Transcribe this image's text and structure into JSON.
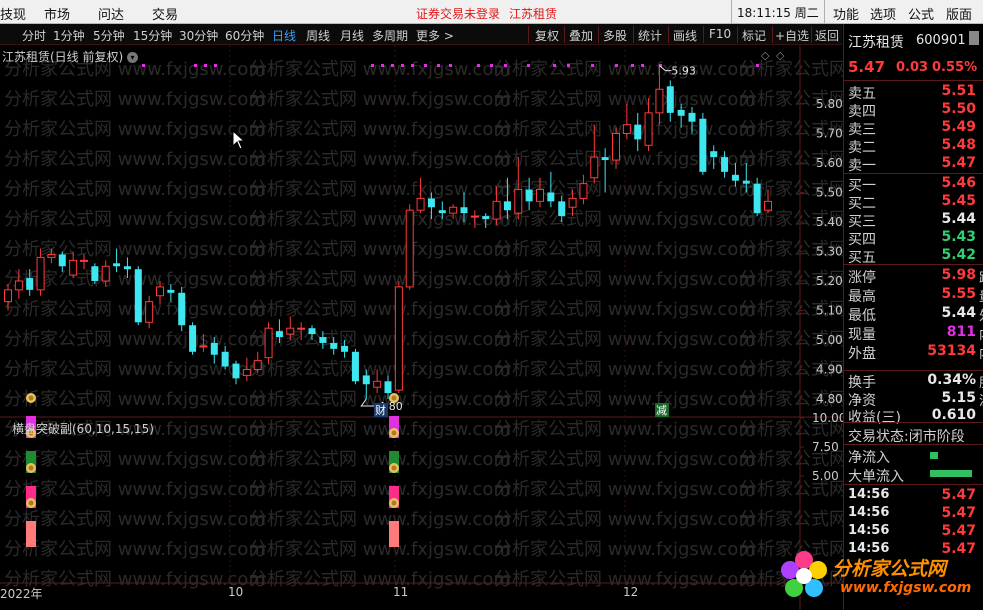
{
  "menubar": {
    "items": [
      "技现",
      "市场",
      "问达",
      "交易"
    ],
    "notice": "证券交易未登录",
    "stock_name": "江苏租赁",
    "clock": "18:11:15 周二",
    "right_items": [
      "功能",
      "选项",
      "公式",
      "版面"
    ]
  },
  "toolbar": {
    "periods": [
      "分时",
      "1分钟",
      "5分钟",
      "15分钟",
      "30分钟",
      "60分钟",
      "日线",
      "周线",
      "月线",
      "多周期",
      "更多 >"
    ],
    "active_period": "日线",
    "tools": [
      "复权",
      "叠加",
      "多股",
      "统计",
      "画线",
      "F10",
      "标记",
      "+自选",
      "返回"
    ]
  },
  "chart": {
    "title": "江苏租赁(日线 前复权)",
    "indicator_title": "横盘突破副(60,10,15,15)",
    "price_ticks": [
      "5.80",
      "5.70",
      "5.60",
      "5.50",
      "5.40",
      "5.30",
      "5.20",
      "5.10",
      "5.00",
      "4.90",
      "4.80"
    ],
    "ind_ticks": [
      "10.00",
      "7.50",
      "5.00"
    ],
    "high_marker": "5.93",
    "low_marker": "4.80",
    "event_a": "财",
    "event_b": "减",
    "x_labels": [
      "2022年",
      "10",
      "11",
      "12"
    ],
    "watermark_text": "分析家公式网 www.fxjgsw.com",
    "colors": {
      "up": "#ff3a3a",
      "down": "#3ee6f0",
      "axis": "#5a1a1a"
    }
  },
  "chart_data": {
    "type": "candlestick",
    "ylim": [
      4.75,
      5.98
    ],
    "ylabel": "",
    "candles": [
      {
        "o": 5.13,
        "c": 5.17,
        "h": 5.19,
        "l": 5.1
      },
      {
        "o": 5.17,
        "c": 5.2,
        "h": 5.24,
        "l": 5.14
      },
      {
        "o": 5.21,
        "c": 5.17,
        "h": 5.24,
        "l": 5.15
      },
      {
        "o": 5.17,
        "c": 5.28,
        "h": 5.31,
        "l": 5.15
      },
      {
        "o": 5.28,
        "c": 5.29,
        "h": 5.31,
        "l": 5.26
      },
      {
        "o": 5.29,
        "c": 5.25,
        "h": 5.3,
        "l": 5.23
      },
      {
        "o": 5.22,
        "c": 5.27,
        "h": 5.3,
        "l": 5.21
      },
      {
        "o": 5.27,
        "c": 5.27,
        "h": 5.29,
        "l": 5.24
      },
      {
        "o": 5.25,
        "c": 5.2,
        "h": 5.26,
        "l": 5.19
      },
      {
        "o": 5.2,
        "c": 5.25,
        "h": 5.27,
        "l": 5.18
      },
      {
        "o": 5.26,
        "c": 5.25,
        "h": 5.31,
        "l": 5.23
      },
      {
        "o": 5.25,
        "c": 5.24,
        "h": 5.28,
        "l": 5.21
      },
      {
        "o": 5.24,
        "c": 5.06,
        "h": 5.25,
        "l": 5.05
      },
      {
        "o": 5.06,
        "c": 5.13,
        "h": 5.15,
        "l": 5.04
      },
      {
        "o": 5.15,
        "c": 5.18,
        "h": 5.2,
        "l": 5.12
      },
      {
        "o": 5.17,
        "c": 5.16,
        "h": 5.19,
        "l": 5.13
      },
      {
        "o": 5.16,
        "c": 5.05,
        "h": 5.18,
        "l": 5.03
      },
      {
        "o": 5.05,
        "c": 4.96,
        "h": 5.06,
        "l": 4.95
      },
      {
        "o": 4.98,
        "c": 4.98,
        "h": 5.02,
        "l": 4.96
      },
      {
        "o": 4.99,
        "c": 4.95,
        "h": 5.01,
        "l": 4.92
      },
      {
        "o": 4.96,
        "c": 4.91,
        "h": 4.98,
        "l": 4.9
      },
      {
        "o": 4.92,
        "c": 4.87,
        "h": 4.93,
        "l": 4.85
      },
      {
        "o": 4.88,
        "c": 4.9,
        "h": 4.94,
        "l": 4.86
      },
      {
        "o": 4.9,
        "c": 4.93,
        "h": 4.96,
        "l": 4.89
      },
      {
        "o": 4.94,
        "c": 5.04,
        "h": 5.06,
        "l": 4.92
      },
      {
        "o": 5.03,
        "c": 5.01,
        "h": 5.07,
        "l": 4.99
      },
      {
        "o": 5.02,
        "c": 5.04,
        "h": 5.08,
        "l": 5.0
      },
      {
        "o": 5.04,
        "c": 5.04,
        "h": 5.06,
        "l": 5.0
      },
      {
        "o": 5.04,
        "c": 5.02,
        "h": 5.05,
        "l": 5.0
      },
      {
        "o": 5.01,
        "c": 4.99,
        "h": 5.03,
        "l": 4.97
      },
      {
        "o": 4.99,
        "c": 4.97,
        "h": 5.01,
        "l": 4.95
      },
      {
        "o": 4.98,
        "c": 4.96,
        "h": 5.0,
        "l": 4.94
      },
      {
        "o": 4.96,
        "c": 4.86,
        "h": 4.97,
        "l": 4.85
      },
      {
        "o": 4.88,
        "c": 4.85,
        "h": 4.9,
        "l": 4.8
      },
      {
        "o": 4.84,
        "c": 4.86,
        "h": 4.9,
        "l": 4.82
      },
      {
        "o": 4.86,
        "c": 4.82,
        "h": 4.88,
        "l": 4.8
      },
      {
        "o": 4.83,
        "c": 5.18,
        "h": 5.2,
        "l": 4.82
      },
      {
        "o": 5.18,
        "c": 5.44,
        "h": 5.46,
        "l": 5.17
      },
      {
        "o": 5.44,
        "c": 5.48,
        "h": 5.55,
        "l": 5.43
      },
      {
        "o": 5.48,
        "c": 5.45,
        "h": 5.5,
        "l": 5.41
      },
      {
        "o": 5.44,
        "c": 5.43,
        "h": 5.47,
        "l": 5.41
      },
      {
        "o": 5.43,
        "c": 5.45,
        "h": 5.46,
        "l": 5.41
      },
      {
        "o": 5.45,
        "c": 5.43,
        "h": 5.5,
        "l": 5.4
      },
      {
        "o": 5.42,
        "c": 5.42,
        "h": 5.44,
        "l": 5.38
      },
      {
        "o": 5.42,
        "c": 5.41,
        "h": 5.43,
        "l": 5.38
      },
      {
        "o": 5.41,
        "c": 5.47,
        "h": 5.52,
        "l": 5.39
      },
      {
        "o": 5.47,
        "c": 5.44,
        "h": 5.55,
        "l": 5.41
      },
      {
        "o": 5.43,
        "c": 5.51,
        "h": 5.62,
        "l": 5.41
      },
      {
        "o": 5.51,
        "c": 5.47,
        "h": 5.55,
        "l": 5.44
      },
      {
        "o": 5.47,
        "c": 5.51,
        "h": 5.55,
        "l": 5.45
      },
      {
        "o": 5.5,
        "c": 5.47,
        "h": 5.57,
        "l": 5.45
      },
      {
        "o": 5.47,
        "c": 5.42,
        "h": 5.49,
        "l": 5.4
      },
      {
        "o": 5.45,
        "c": 5.48,
        "h": 5.51,
        "l": 5.42
      },
      {
        "o": 5.48,
        "c": 5.53,
        "h": 5.56,
        "l": 5.46
      },
      {
        "o": 5.55,
        "c": 5.62,
        "h": 5.73,
        "l": 5.53
      },
      {
        "o": 5.62,
        "c": 5.61,
        "h": 5.65,
        "l": 5.5
      },
      {
        "o": 5.61,
        "c": 5.7,
        "h": 5.72,
        "l": 5.58
      },
      {
        "o": 5.7,
        "c": 5.73,
        "h": 5.8,
        "l": 5.68
      },
      {
        "o": 5.73,
        "c": 5.68,
        "h": 5.77,
        "l": 5.64
      },
      {
        "o": 5.66,
        "c": 5.77,
        "h": 5.82,
        "l": 5.64
      },
      {
        "o": 5.77,
        "c": 5.85,
        "h": 5.93,
        "l": 5.73
      },
      {
        "o": 5.86,
        "c": 5.77,
        "h": 5.88,
        "l": 5.74
      },
      {
        "o": 5.78,
        "c": 5.76,
        "h": 5.8,
        "l": 5.72
      },
      {
        "o": 5.77,
        "c": 5.74,
        "h": 5.79,
        "l": 5.7
      },
      {
        "o": 5.75,
        "c": 5.57,
        "h": 5.77,
        "l": 5.56
      },
      {
        "o": 5.64,
        "c": 5.62,
        "h": 5.66,
        "l": 5.58
      },
      {
        "o": 5.62,
        "c": 5.57,
        "h": 5.64,
        "l": 5.55
      },
      {
        "o": 5.56,
        "c": 5.54,
        "h": 5.6,
        "l": 5.52
      },
      {
        "o": 5.54,
        "c": 5.53,
        "h": 5.6,
        "l": 5.5
      },
      {
        "o": 5.53,
        "c": 5.43,
        "h": 5.55,
        "l": 5.42
      },
      {
        "o": 5.44,
        "c": 5.47,
        "h": 5.51,
        "l": 5.43
      }
    ]
  },
  "quote": {
    "name": "江苏租赁",
    "code": "600901",
    "price": "5.47",
    "change": "0.03",
    "change_pct": "0.55%",
    "asks": [
      {
        "label": "卖五",
        "price": "5.51"
      },
      {
        "label": "卖四",
        "price": "5.50"
      },
      {
        "label": "卖三",
        "price": "5.49"
      },
      {
        "label": "卖二",
        "price": "5.48"
      },
      {
        "label": "卖一",
        "price": "5.47"
      }
    ],
    "bids": [
      {
        "label": "买一",
        "price": "5.46"
      },
      {
        "label": "买二",
        "price": "5.45"
      },
      {
        "label": "买三",
        "price": "5.44"
      },
      {
        "label": "买四",
        "price": "5.43"
      },
      {
        "label": "买五",
        "price": "5.42"
      }
    ],
    "stats": [
      {
        "label": "涨停",
        "value": "5.98",
        "extra": "跌"
      },
      {
        "label": "最高",
        "value": "5.55",
        "extra": "量"
      },
      {
        "label": "最低",
        "value": "5.44",
        "extra": "外"
      },
      {
        "label": "现量",
        "value": "811",
        "extra": "内"
      },
      {
        "label": "外盘",
        "value": "53134",
        "extra": "内"
      }
    ],
    "fin": [
      {
        "label": "换手",
        "value": "0.34%",
        "extra": "股"
      },
      {
        "label": "净资",
        "value": "5.15",
        "extra": "流"
      },
      {
        "label": "收益(三)",
        "value": "0.610",
        "extra": "P"
      }
    ],
    "trade_status_label": "交易状态:",
    "trade_status_value": "闭市阶段",
    "net_inflow_label": "净流入",
    "big_inflow_label": "大单流入",
    "ticks": [
      {
        "time": "14:56",
        "price": "5.47"
      },
      {
        "time": "14:56",
        "price": "5.47"
      },
      {
        "time": "14:56",
        "price": "5.47"
      },
      {
        "time": "14:56",
        "price": "5.47"
      }
    ]
  },
  "logo": {
    "brand": "分析家公式网",
    "url": "www.fxjgsw.com"
  }
}
